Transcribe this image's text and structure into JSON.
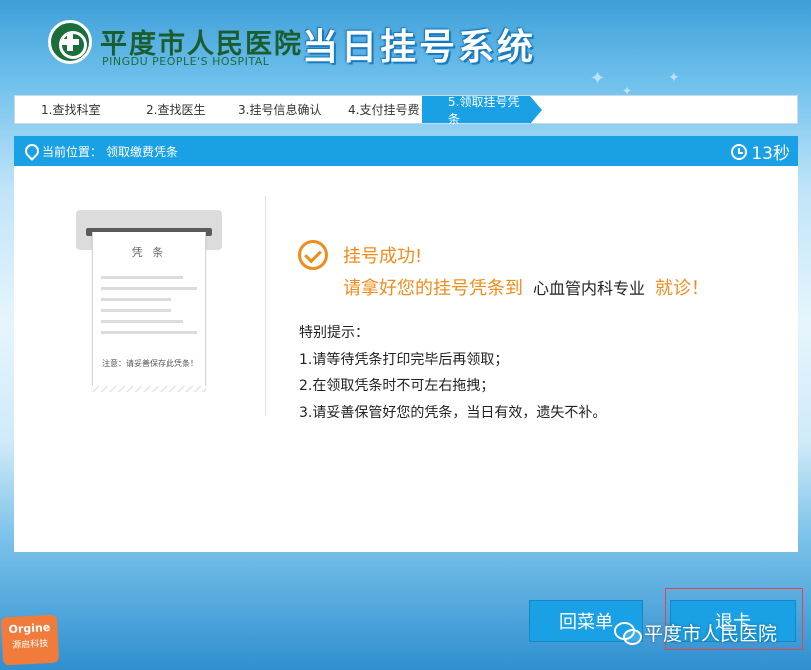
{
  "header": {
    "hospital_name": "平度市人民医院",
    "hospital_name_en": "PINGDU PEOPLE'S HOSPITAL",
    "system_title": "当日挂号系统"
  },
  "steps": [
    {
      "label": "1.查找科室",
      "active": false
    },
    {
      "label": "2.查找医生",
      "active": false
    },
    {
      "label": "3.挂号信息确认",
      "active": false
    },
    {
      "label": "4.支付挂号费",
      "active": false
    },
    {
      "label": "5.领取挂号凭条",
      "active": true
    }
  ],
  "location": {
    "label": "当前位置：",
    "value": "领取缴费凭条",
    "icon": "location-pin-icon"
  },
  "countdown": {
    "value": "13秒",
    "icon": "alarm-clock-icon"
  },
  "receipt": {
    "title": "凭 条",
    "note": "注意：请妥善保存此凭条！"
  },
  "message": {
    "success": "挂号成功!",
    "take_prefix": "请拿好您的挂号凭条到",
    "department": "心血管内科专业",
    "take_suffix": "就诊！",
    "icon": "check-circle-icon"
  },
  "tips": {
    "title": "特别提示：",
    "items": [
      "1.请等待凭条打印完毕后再领取；",
      "2.在领取凭条时不可左右拖拽；",
      "3.请妥善保管好您的凭条，当日有效，遗失不补。"
    ]
  },
  "buttons": {
    "menu": "回菜单",
    "exit": "退卡"
  },
  "watermark": {
    "text": "平度市人民医院",
    "icon": "wechat-icon"
  },
  "badge": {
    "en": "Orgine",
    "cn": "源启科技"
  },
  "colors": {
    "accent": "#1aa0e4",
    "success": "#f08c1a",
    "logo_green": "#1a5d2e"
  }
}
